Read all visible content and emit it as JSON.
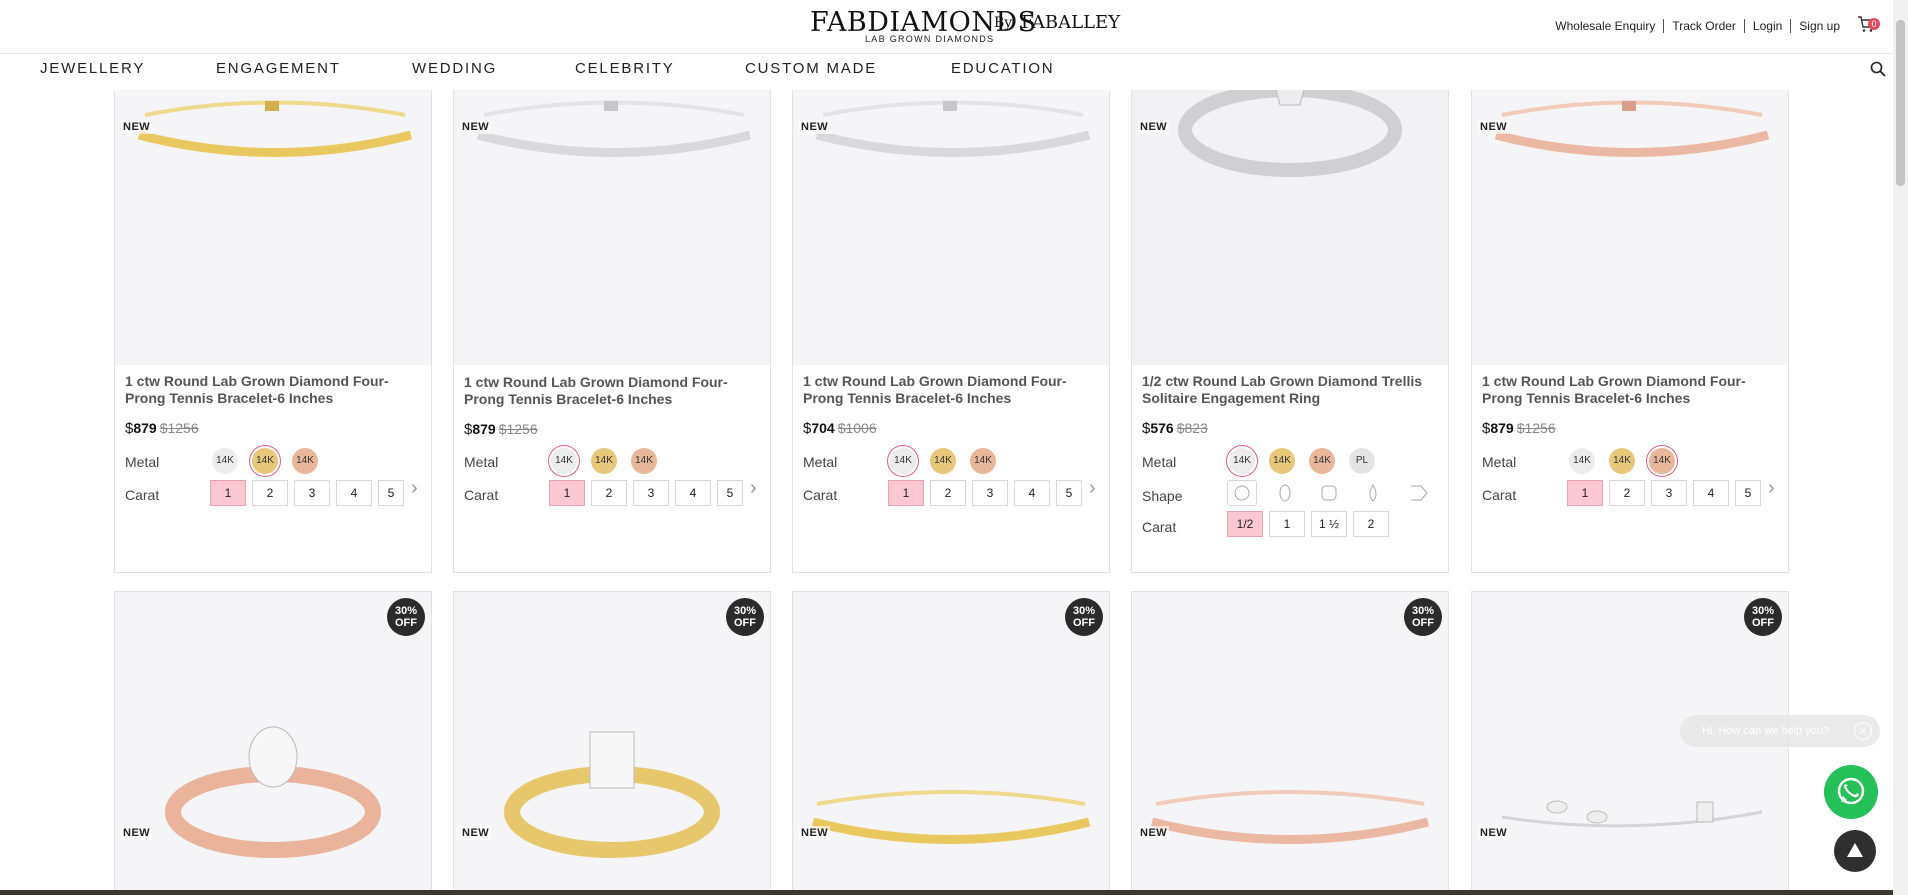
{
  "header": {
    "brand": "FABDIAMONDS",
    "by": "By",
    "byname": "FABALLEY",
    "tagline": "LAB GROWN DIAMONDS",
    "links": [
      "Wholesale Enquiry",
      "Track Order",
      "Login",
      "Sign up"
    ],
    "cart_count": "0"
  },
  "nav": {
    "items": [
      "JEWELLERY",
      "ENGAGEMENT",
      "WEDDING",
      "CELEBRITY",
      "CUSTOM MADE",
      "EDUCATION"
    ]
  },
  "labels": {
    "metal": "Metal",
    "carat": "Carat",
    "shape": "Shape",
    "new": "NEW",
    "off_line1": "30%",
    "off_line2": "OFF"
  },
  "products_row1": [
    {
      "title": "1 ctw Round Lab Grown Diamond Four-Prong Tennis Bracelet-6 Inches",
      "price": "879",
      "old_price": "$1256",
      "metals": [
        "14K",
        "14K",
        "14K"
      ],
      "carats": [
        "1",
        "2",
        "3",
        "4",
        "5"
      ]
    },
    {
      "title": "1 ctw Round Lab Grown Diamond Four-Prong Tennis Bracelet-6 Inches",
      "price": "879",
      "old_price": "$1256",
      "metals": [
        "14K",
        "14K",
        "14K"
      ],
      "carats": [
        "1",
        "2",
        "3",
        "4",
        "5"
      ]
    },
    {
      "title": "1 ctw Round Lab Grown Diamond Four-Prong Tennis Bracelet-6 Inches",
      "price": "704",
      "old_price": "$1006",
      "metals": [
        "14K",
        "14K",
        "14K"
      ],
      "carats": [
        "1",
        "2",
        "3",
        "4",
        "5"
      ]
    },
    {
      "title": "1/2 ctw Round Lab Grown Diamond Trellis Solitaire Engagement Ring",
      "price": "576",
      "old_price": "$823",
      "metals": [
        "14K",
        "14K",
        "14K",
        "PL"
      ],
      "carats": [
        "1/2",
        "1",
        "1 ½",
        "2"
      ]
    },
    {
      "title": "1 ctw Round Lab Grown Diamond Four-Prong Tennis Bracelet-6 Inches",
      "price": "879",
      "old_price": "$1256",
      "metals": [
        "14K",
        "14K",
        "14K"
      ],
      "carats": [
        "1",
        "2",
        "3",
        "4",
        "5"
      ]
    }
  ],
  "currency": "$",
  "chat": {
    "placeholder": "Hi, How can we help you?"
  },
  "colors": {
    "accent_pink": "#fbc7d2",
    "badge_dark": "#2b2b2b",
    "whatsapp_green": "#25c05a",
    "cart_red": "#e5485d"
  }
}
